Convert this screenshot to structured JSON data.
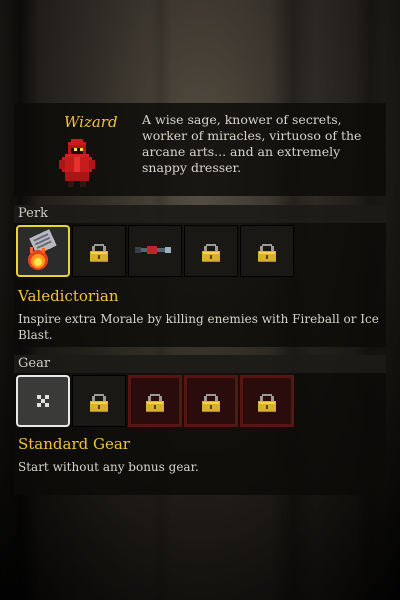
{
  "class": {
    "name": "Wizard",
    "description": "A wise sage, knower of secrets, worker of miracles, virtuoso of the arcane arts... and an extremely snappy dresser."
  },
  "perk": {
    "section_label": "Perk",
    "selected_name": "Valedictorian",
    "selected_description": "Inspire extra Morale by killing enemies with Fireball or Ice Blast.",
    "slots": [
      {
        "icon": "fireball-book-icon",
        "locked": false,
        "selected": true
      },
      {
        "icon": "locked-perk-icon",
        "locked": true
      },
      {
        "icon": "dart-perk-icon",
        "locked": false
      },
      {
        "icon": "locked-perk-icon",
        "locked": true
      },
      {
        "icon": "locked-perk-icon",
        "locked": true
      }
    ]
  },
  "gear": {
    "section_label": "Gear",
    "selected_name": "Standard Gear",
    "selected_description": "Start without any bonus gear.",
    "slots": [
      {
        "icon": "no-gear-x-icon",
        "locked": false,
        "selected": true
      },
      {
        "icon": "locked-gear-icon",
        "locked": true
      },
      {
        "icon": "locked-gear-icon",
        "locked": true
      },
      {
        "icon": "locked-gear-icon",
        "locked": true
      },
      {
        "icon": "locked-gear-icon",
        "locked": true
      }
    ]
  },
  "colors": {
    "accent_gold": "#f0c33c",
    "perk_select_border": "#e8d630",
    "gear_select_border": "#e8e8e8",
    "locked_red": "#5a1414"
  }
}
